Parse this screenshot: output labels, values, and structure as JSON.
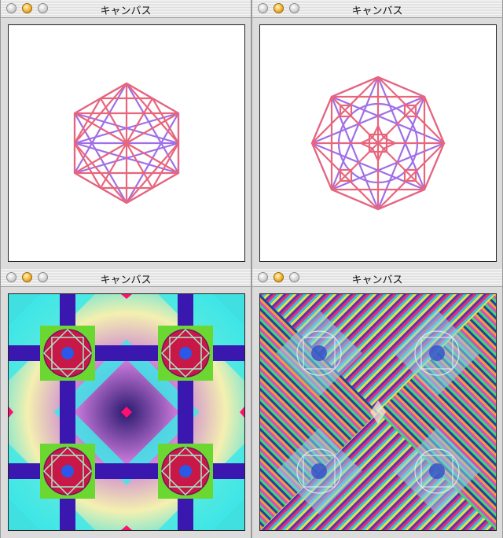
{
  "windows": [
    {
      "title": "キャンバス",
      "content": "pattern"
    },
    {
      "title": "キャンバス",
      "content": "pattern"
    },
    {
      "title": "キャンバス",
      "content": "pattern"
    },
    {
      "title": "キャンバス",
      "content": "pattern"
    }
  ],
  "colors": {
    "outline_red": "#e8657c",
    "outline_purple": "#9f6fe8",
    "canvas_bg": "#ffffff",
    "titlebar": "#e6e6e6"
  },
  "icons": {
    "close": "close-icon",
    "minimize": "minimize-icon",
    "zoom": "zoom-icon"
  }
}
